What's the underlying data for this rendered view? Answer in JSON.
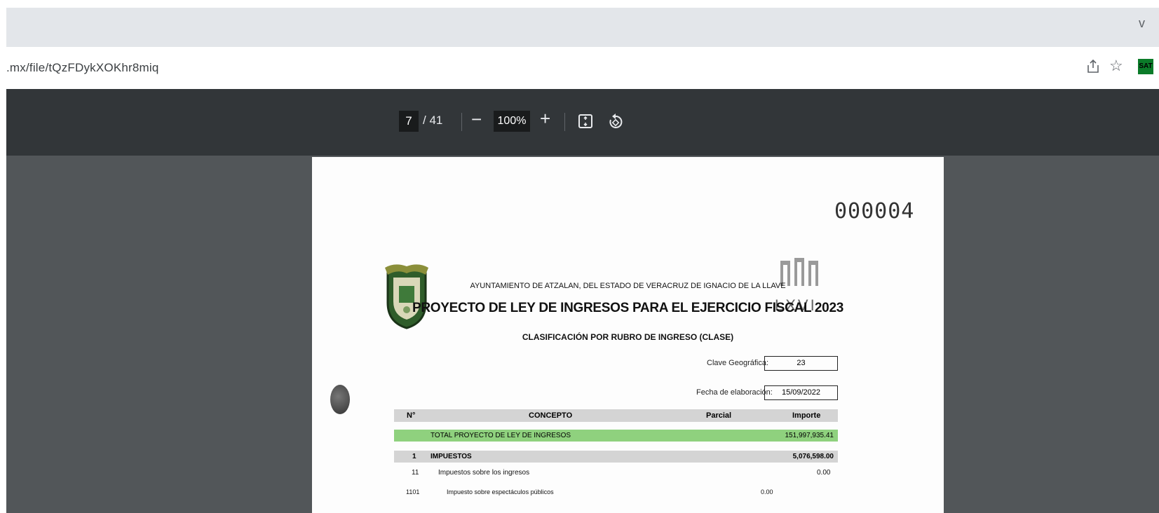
{
  "browser": {
    "url": ".mx/file/tQzFDykXOKhr8miq",
    "tab_chevron": "v",
    "extension_label": "SAT"
  },
  "pdf_toolbar": {
    "current_page": "7",
    "total_pages": "/ 41",
    "zoom_out_label": "−",
    "zoom_value": "100%",
    "zoom_in_label": "+"
  },
  "document": {
    "doc_number": "000004",
    "org_line": "AYUNTAMIENTO DE ATZALAN, DEL ESTADO DE VERACRUZ DE IGNACIO DE LA LLAVE",
    "title": "PROYECTO DE LEY DE INGRESOS PARA EL EJERCICIO FISCAL 2023",
    "subtitle": "CLASIFICACIÓN POR RUBRO DE INGRESO (CLASE)",
    "seal_right_text": "LXVI",
    "clave_label": "Clave Geográfica:",
    "clave_value": "23",
    "fecha_label": "Fecha de elaboración:",
    "fecha_value": "15/09/2022",
    "table": {
      "headers": {
        "num": "N°",
        "concepto": "CONCEPTO",
        "parcial": "Parcial",
        "importe": "Importe"
      },
      "total_label": "TOTAL PROYECTO DE LEY DE INGRESOS",
      "total_value": "151,997,935.41",
      "impuestos_num": "1",
      "impuestos_label": "IMPUESTOS",
      "impuestos_value": "5,076,598.00",
      "row11_num": "11",
      "row11_label": "Impuestos sobre los ingresos",
      "row11_value": "0.00",
      "row1101_num": "1101",
      "row1101_label": "Impuesto sobre espectáculos públicos",
      "row1101_value": "0.00"
    }
  },
  "colors": {
    "toolbar": "#323639",
    "viewer_bg": "#525659",
    "total_row": "#8fd17e",
    "header_row": "#d4d4d4"
  }
}
